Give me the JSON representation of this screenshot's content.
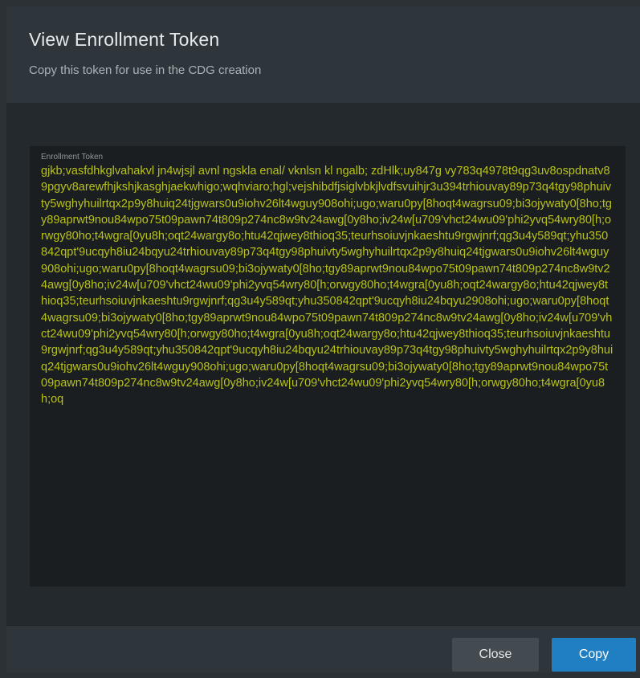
{
  "modal": {
    "title": "View Enrollment Token",
    "subtitle": "Copy this token for use in the CDG creation"
  },
  "token": {
    "label": "Enrollment Token",
    "value": "gjkb;vasfdhkglvahakvl jn4wjsjl avnl ngskla enal/ vknlsn kl ngalb; zdHlk;uy847g vy783q4978t9qg3uv8ospdnatv89pgyv8arewfhjkshjkasghjaekwhigo;wqhviaro;hgl;vejshibdfjsiglvbkjlvdfsvuihjr3u394trhiouvay89p73q4tgy98phuivty5wghyhuilrtqx2p9y8huiq24tjgwars0u9iohv26lt4wguy908ohi;ugo;waru0py[8hoqt4wagrsu09;bi3ojywaty0[8ho;tgy89aprwt9nou84wpo75t09pawn74t809p274nc8w9tv24awg[0y8ho;iv24w[u709'vhct24wu09'phi2yvq54wry80[h;orwgy80ho;t4wgra[0yu8h;oqt24wargy8o;htu42qjwey8thioq35;teurhsoiuvjnkaeshtu9rgwjnrf;qg3u4y589qt;yhu350842qpt'9ucqyh8iu24bqyu24trhiouvay89p73q4tgy98phuivty5wghyhuilrtqx2p9y8huiq24tjgwars0u9iohv26lt4wguy908ohi;ugo;waru0py[8hoqt4wagrsu09;bi3ojywaty0[8ho;tgy89aprwt9nou84wpo75t09pawn74t809p274nc8w9tv24awg[0y8ho;iv24w[u709'vhct24wu09'phi2yvq54wry80[h;orwgy80ho;t4wgra[0yu8h;oqt24wargy8o;htu42qjwey8thioq35;teurhsoiuvjnkaeshtu9rgwjnrf;qg3u4y589qt;yhu350842qpt'9ucqyh8iu24bqyu2908ohi;ugo;waru0py[8hoqt4wagrsu09;bi3ojywaty0[8ho;tgy89aprwt9nou84wpo75t09pawn74t809p274nc8w9tv24awg[0y8ho;iv24w[u709'vhct24wu09'phi2yvq54wry80[h;orwgy80ho;t4wgra[0yu8h;oqt24wargy8o;htu42qjwey8thioq35;teurhsoiuvjnkaeshtu9rgwjnrf;qg3u4y589qt;yhu350842qpt'9ucqyh8iu24bqyu24trhiouvay89p73q4tgy98phuivty5wghyhuilrtqx2p9y8huiq24tjgwars0u9iohv26lt4wguy908ohi;ugo;waru0py[8hoqt4wagrsu09;bi3ojywaty0[8ho;tgy89aprwt9nou84wpo75t09pawn74t809p274nc8w9tv24awg[0y8ho;iv24w[u709'vhct24wu09'phi2yvq54wry80[h;orwgy80ho;t4wgra[0yu8h;oq"
  },
  "footer": {
    "close_label": "Close",
    "copy_label": "Copy"
  },
  "colors": {
    "token_text": "#b9c218",
    "primary_button": "#1f7fc2",
    "secondary_button": "#434b51"
  }
}
